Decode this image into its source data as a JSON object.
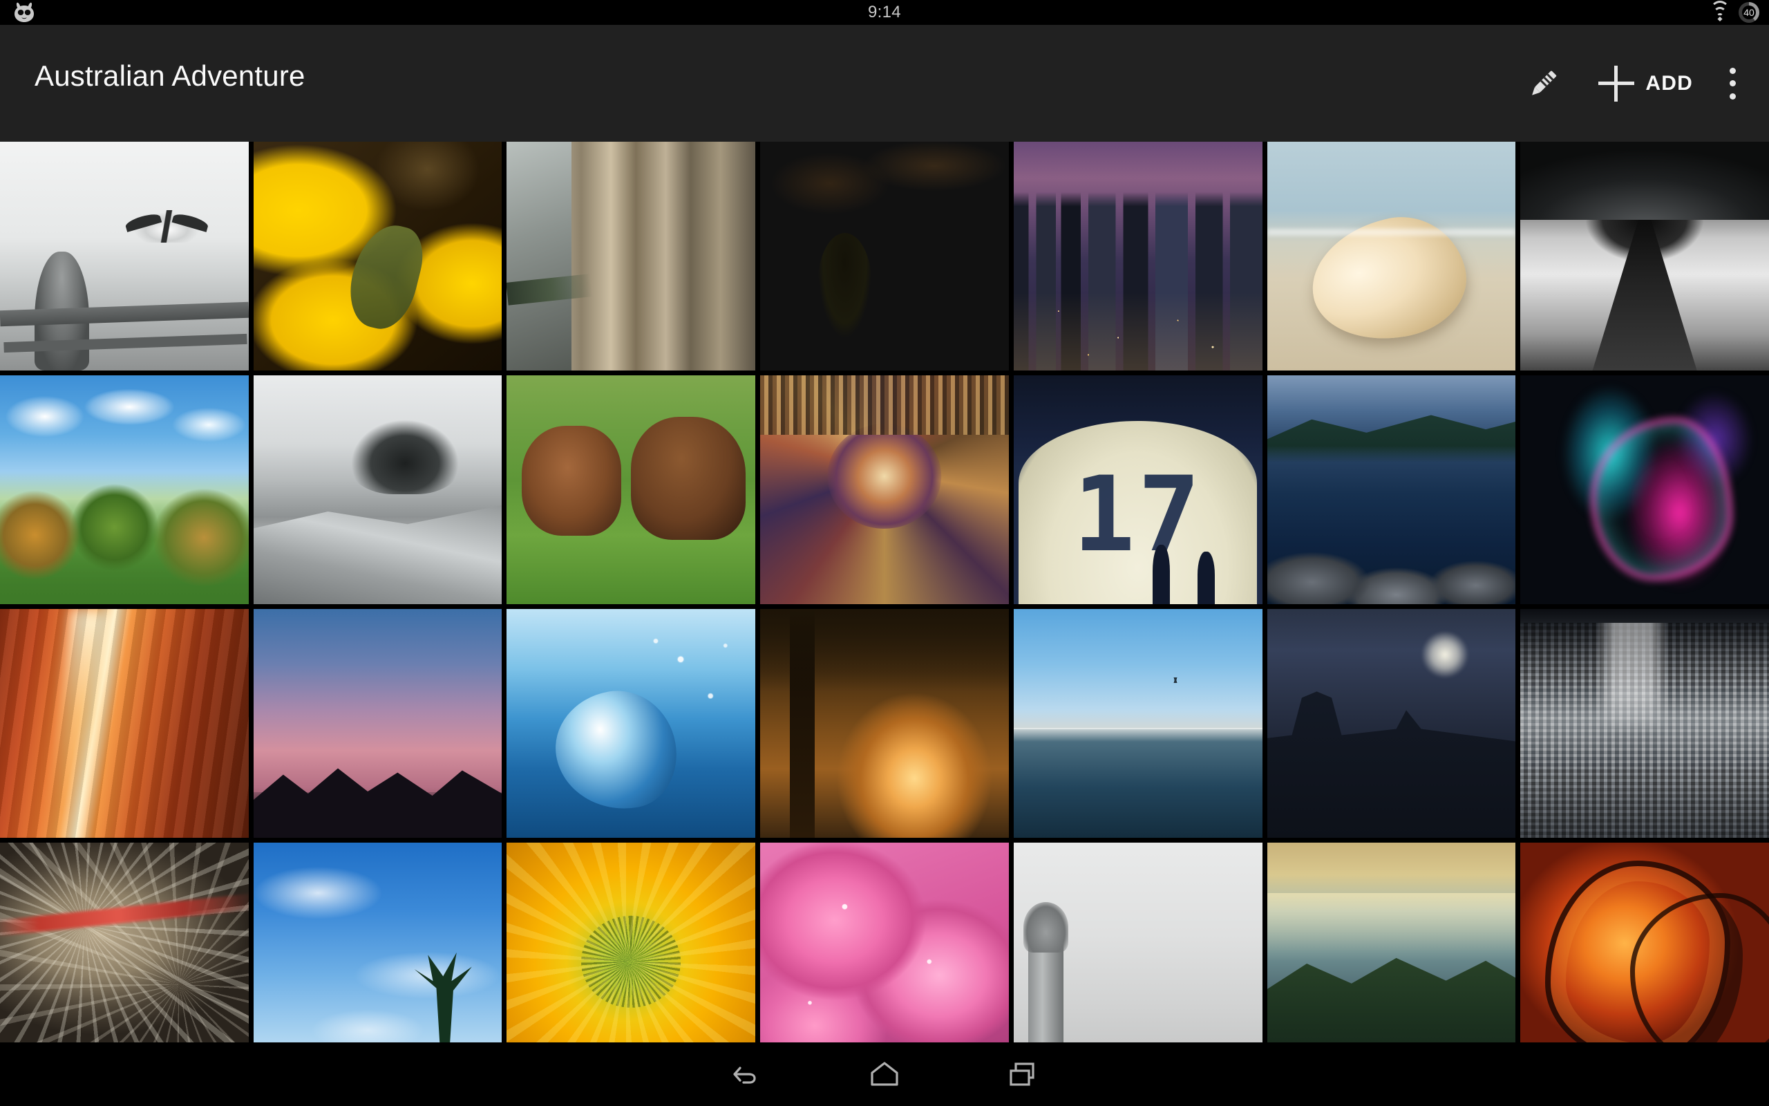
{
  "status_bar": {
    "logo_icon": "cyanogenmod-logo",
    "clock": "9:14",
    "wifi_icon": "wifi-icon",
    "battery_icon": "battery-circle-icon",
    "battery_level": "40"
  },
  "app_bar": {
    "title": "Australian Adventure",
    "actions": {
      "edit_icon": "pencil-icon",
      "add_icon": "plus-icon",
      "add_label": "ADD",
      "overflow_icon": "overflow-menu-icon"
    },
    "background_color": "#212121"
  },
  "grid": {
    "columns": 7,
    "rows": 4,
    "photos": [
      {
        "name": "photo-seaside-viewer-gull",
        "alt": "Black and white coin-operated viewer on pier with flying seagull",
        "art": "p-viewer"
      },
      {
        "name": "photo-sunflower-petals",
        "alt": "Yellow sunflower petals on dark brown background",
        "art": "p-sunpetal"
      },
      {
        "name": "photo-stone-bridge",
        "alt": "Stone bridge with classical columns",
        "art": "p-bridge"
      },
      {
        "name": "photo-lone-tree-sunset",
        "alt": "Lone tree silhouette against golden sunset clouds",
        "art": "p-tree"
      },
      {
        "name": "photo-city-skyline-dusk",
        "alt": "Downtown skyscrapers at dusk with purple sky",
        "art": "p-city"
      },
      {
        "name": "photo-seashell-beach",
        "alt": "Conch seashell resting on sandy beach",
        "art": "p-shell"
      },
      {
        "name": "photo-subway-tunnel",
        "alt": "Black and white subway station platform and tunnel",
        "art": "p-subway"
      },
      {
        "name": "photo-green-bushes-sky",
        "alt": "Green bushes under blue sky with white clouds",
        "art": "p-bush"
      },
      {
        "name": "photo-rocky-hill-pine",
        "alt": "Black and white rocky hillside with windswept pine",
        "art": "p-rocks"
      },
      {
        "name": "photo-grazing-horses",
        "alt": "Brown horses grazing on green pasture",
        "art": "p-horses"
      },
      {
        "name": "photo-kaleidoscope-fractal",
        "alt": "Ornate symmetrical kaleidoscope fractal artwork",
        "art": "p-kaleido"
      },
      {
        "name": "photo-digital-seventeen-wall",
        "alt": "Giant digital 17 projected on wall with walking silhouettes",
        "art": "p-seventeen",
        "digits": "17"
      },
      {
        "name": "photo-harbor-dusk",
        "alt": "Marina harbor at dusk with mountains and rocks",
        "art": "p-harbor"
      },
      {
        "name": "photo-magenta-smoke",
        "alt": "Abstract magenta and cyan smoke on black",
        "art": "p-smoke"
      },
      {
        "name": "photo-slot-canyon",
        "alt": "Orange sandstone slot canyon with light beam",
        "art": "p-canyon"
      },
      {
        "name": "photo-palm-silhouettes",
        "alt": "Palm tree silhouettes against pink dusk sky",
        "art": "p-palms"
      },
      {
        "name": "photo-water-splash",
        "alt": "Blue water splash with droplets",
        "art": "p-water"
      },
      {
        "name": "photo-backlit-forest",
        "alt": "Backlit tree in warm misty forest",
        "art": "p-forest"
      },
      {
        "name": "photo-sea-horizon-bird",
        "alt": "Calm sea horizon with a distant bird",
        "art": "p-sea"
      },
      {
        "name": "photo-moonlit-church",
        "alt": "Gothic church silhouette under moonlit night sky",
        "art": "p-church"
      },
      {
        "name": "photo-aerial-cityscape",
        "alt": "Black and white aerial view of dense city skyscrapers",
        "art": "p-aerial"
      },
      {
        "name": "photo-silky-fibers",
        "alt": "Abstract silky fibrous fractal in tan with red streak",
        "art": "p-fibers"
      },
      {
        "name": "photo-blue-sky-palm",
        "alt": "Bright blue sky with wispy clouds and palm fronds",
        "art": "p-bluesky"
      },
      {
        "name": "photo-sunflower-macro",
        "alt": "Macro close-up of sunflower seed head center",
        "art": "p-sunflower"
      },
      {
        "name": "photo-pink-hydrangea",
        "alt": "Pink hydrangea blossom close-up",
        "art": "p-hydrangea"
      },
      {
        "name": "photo-pale-monument",
        "alt": "Pale stone monument against grey sky",
        "art": "p-monument"
      },
      {
        "name": "photo-coastal-cliff",
        "alt": "Coastal cliff and sea at sunrise",
        "art": "p-coast"
      },
      {
        "name": "photo-orange-fractal",
        "alt": "Orange and red abstract fractal arcs",
        "art": "p-fractal"
      }
    ]
  },
  "nav_bar": {
    "back_icon": "back-arrow-icon",
    "home_icon": "home-icon",
    "recents_icon": "recent-apps-icon"
  }
}
